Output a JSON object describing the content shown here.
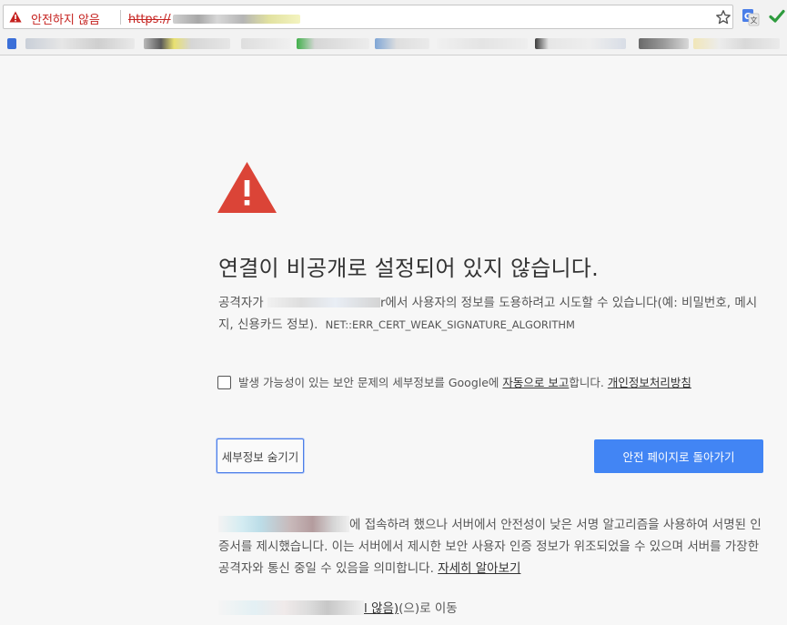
{
  "browser": {
    "security_label": "안전하지 않음",
    "url_scheme": "https://",
    "accent_insecure": "#c5221f"
  },
  "bookmarks_bar": {
    "items_visible_as_blurred": true
  },
  "interstitial": {
    "icon": "red-warning-triangle-icon",
    "icon_color": "#db4437",
    "headline": "연결이 비공개로 설정되어 있지 않습니다.",
    "explanation_prefix": "공격자가 ",
    "explanation_host_tail": "r",
    "explanation_body": "에서 사용자의 정보를 도용하려고 시도할 수 있습니다(예: 비밀번호, 메시지, 신용카드 정보).",
    "error_code": "NET::ERR_CERT_WEAK_SIGNATURE_ALGORITHM",
    "report": {
      "text_before": "발생 가능성이 있는 보안 문제의 세부정보를 Google에 ",
      "link_auto_report": "자동으로 보고",
      "text_after": "합니다. ",
      "link_privacy": "개인정보처리방침",
      "checked": false
    },
    "buttons": {
      "hide_details": "세부정보 숨기기",
      "back_to_safety": "안전 페이지로 돌아가기",
      "primary_color": "#4285f4"
    },
    "details": {
      "text": "에 접속하려 했으나 서버에서 안전성이 낮은 서명 알고리즘을 사용하여 서명된 인증서를 제시했습니다. 이는 서버에서 제시한 보안 사용자 인증 정보가 위조되었을 수 있으며 서버를 가장한 공격자와 통신 중일 수 있음을 의미합니다. ",
      "learn_more_link": "자세히 알아보기"
    },
    "proceed": {
      "link_tail": "l 않음)",
      "suffix": "(으)로 이동"
    }
  }
}
